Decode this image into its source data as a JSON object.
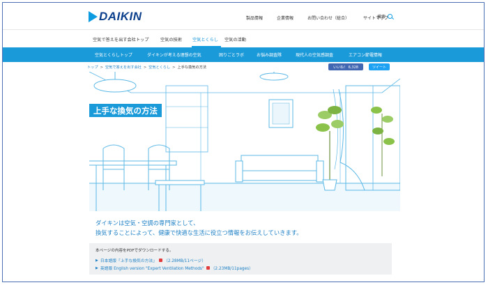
{
  "brand": {
    "logo_text": "DAIKIN",
    "accent": "#1b9ad9",
    "logo_color": "#0b3f8c"
  },
  "util_nav": [
    "製品情報",
    "企業情報",
    "お問い合わせ（総合）",
    "サイトマップ"
  ],
  "search_label": "検索",
  "section_tabs": [
    {
      "label": "空気で答えを出す会社トップ",
      "active": false
    },
    {
      "label": "空気の技術",
      "active": false
    },
    {
      "label": "空気とくらし",
      "active": true
    },
    {
      "label": "空気の活動",
      "active": false
    }
  ],
  "blue_nav": [
    "空気とくらしトップ",
    "ダイキンが考える理想の空気",
    "困りごとラボ",
    "お悩み調査隊",
    "現代人の空気感調査",
    "エアコン節電情報"
  ],
  "breadcrumb": [
    "トップ",
    "空気で答えを出す会社",
    "空気とくらし",
    "上手な換気の方法"
  ],
  "social": {
    "like_label": "いいね！ 6,328",
    "tweet_label": "ツイート"
  },
  "hero": {
    "title": "上手な換気の方法"
  },
  "intro": {
    "line1": "ダイキンは空気・空調の専門家として、",
    "line2": "換気することによって、健康で快適な生活に役立つ情報をお伝えしていきます。"
  },
  "download": {
    "heading": "本ページの内容をPDFでダウンロードする。",
    "items": [
      {
        "label": "日本語版「上手な換気の方法」",
        "size": "（2.28MB/11ページ）"
      },
      {
        "label": "英語版 English version \"Expert Ventilation Methods\"",
        "size": "（2.23MB/11pages）"
      }
    ]
  }
}
